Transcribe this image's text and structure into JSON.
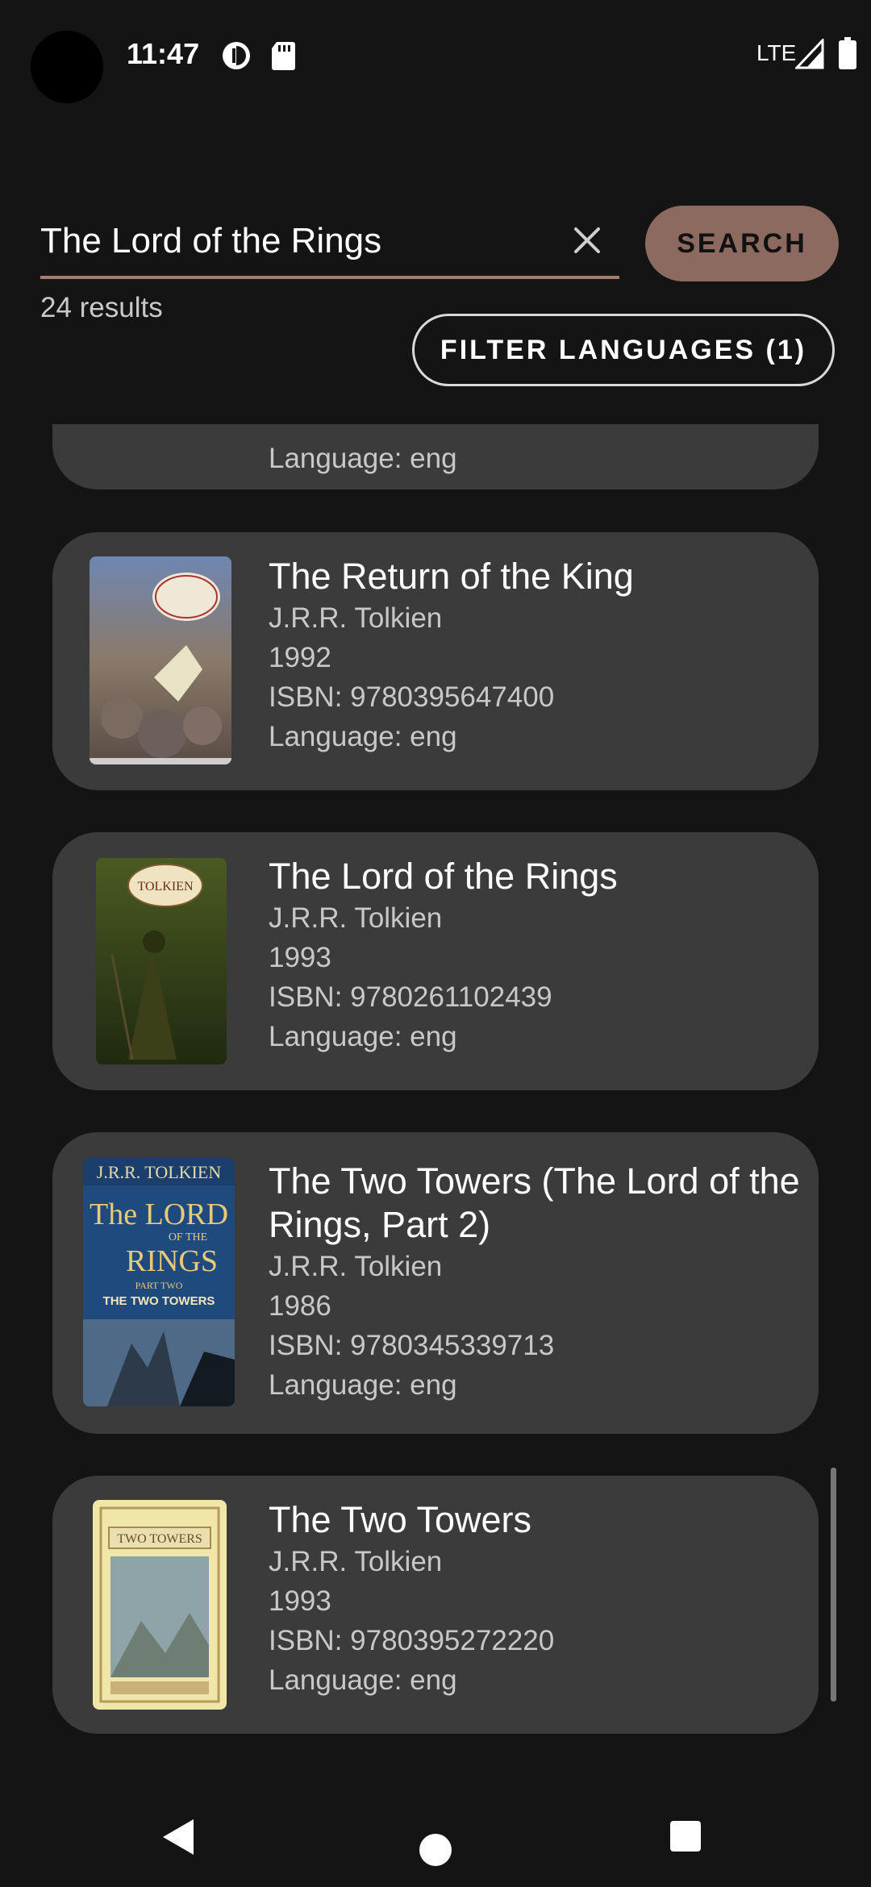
{
  "status_bar": {
    "time": "11:47",
    "network": "LTE",
    "icons": [
      "data-saver-icon",
      "sd-card-icon",
      "signal-icon",
      "battery-icon"
    ]
  },
  "search": {
    "value": "The Lord of the Rings",
    "button_label": "SEARCH",
    "results_count": "24 results",
    "filter_label": "FILTER LANGUAGES (1)"
  },
  "books": [
    {
      "language": "Language: eng"
    },
    {
      "title": "The Return of the King",
      "author": "J.R.R. Tolkien",
      "year": "1992",
      "isbn": "ISBN: 9780395647400",
      "language": "Language: eng"
    },
    {
      "title": "The Lord of the Rings",
      "author": "J.R.R. Tolkien",
      "year": "1993",
      "isbn": "ISBN: 9780261102439",
      "language": "Language: eng"
    },
    {
      "title": "The Two Towers (The Lord of the Rings, Part 2)",
      "author": "J.R.R. Tolkien",
      "year": "1986",
      "isbn": "ISBN: 9780345339713",
      "language": "Language: eng"
    },
    {
      "title": "The Two Towers",
      "author": "J.R.R. Tolkien",
      "year": "1993",
      "isbn": "ISBN: 9780395272220",
      "language": "Language: eng"
    }
  ],
  "covers": {
    "c3_top": "J.R.R. TOLKIEN",
    "c3_big1": "The LORD",
    "c3_small": "OF THE",
    "c3_big2": "RINGS",
    "c3_part": "PART TWO",
    "c3_sub": "THE TWO TOWERS",
    "c2_oval": "TOLKIEN",
    "c4_banner": "TWO TOWERS"
  },
  "colors": {
    "accent": "#8c6a60",
    "underline": "#a77c6f",
    "card": "#3b3b3b",
    "background": "#141414"
  }
}
